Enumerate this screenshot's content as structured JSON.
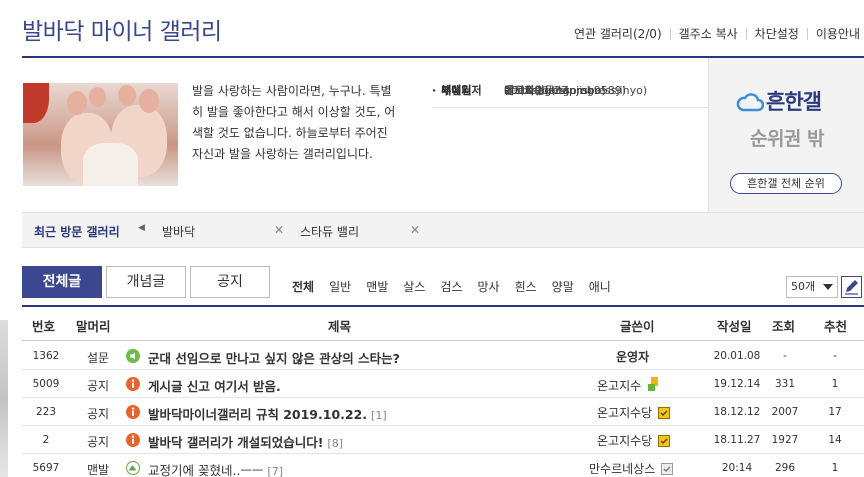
{
  "gallery": {
    "title": "발바닥 마이너 갤러리",
    "intro": "발을 사랑하는 사람이라면, 누구나. 특별히 발을 좋아한다고 해서 이상할 것도, 어색할 것도 없습니다. 하늘로부터 주어진 자신과 발을 사랑하는 갤러리입니다.",
    "info": {
      "manager_label": "매니저",
      "manager": "온고지수(ongojisoo)",
      "submanager_label": "부매니저",
      "submanagers": [
        "박지효연구소(progressjihyo)",
        "에르화(lblossom)",
        "aerttaag(hanmh9589)"
      ],
      "opened_label": "개설일",
      "opened": "2018-11-27"
    }
  },
  "top_links": [
    "연관 갤러리(2/0)",
    "갤주소 복사",
    "차단설정",
    "이용안내"
  ],
  "ranking": {
    "logo": "흔한갤",
    "sub": "순위권 밖",
    "button": "흔한갤 전체 순위"
  },
  "recent": {
    "title": "최근 방문 갤러리",
    "items": [
      "발바닥",
      "스타듀 밸리"
    ]
  },
  "tabs": [
    "전체글",
    "개념글",
    "공지"
  ],
  "subheads": [
    "전체",
    "일반",
    "맨발",
    "살스",
    "검스",
    "망사",
    "흰스",
    "양말",
    "애니"
  ],
  "list_count": "50개",
  "table": {
    "headers": [
      "번호",
      "말머리",
      "제목",
      "글쓴이",
      "작성일",
      "조회",
      "추천"
    ],
    "rows": [
      {
        "num": "1362",
        "head": "설문",
        "title": "군대 선임으로 만나고 싶지 않은 관상의 스타는?",
        "replies": "",
        "writer": "운영자",
        "date": "20.01.08",
        "views": "-",
        "rec": "-"
      },
      {
        "num": "5009",
        "head": "공지",
        "title": "게시글 신고 여기서 받음.",
        "replies": "",
        "writer": "온고지수",
        "date": "19.12.14",
        "views": "331",
        "rec": "1"
      },
      {
        "num": "223",
        "head": "공지",
        "title": "발바닥마이너갤러리 규칙 2019.10.22.",
        "replies": "[1]",
        "writer": "온고지수당",
        "date": "18.12.12",
        "views": "2007",
        "rec": "17"
      },
      {
        "num": "2",
        "head": "공지",
        "title": "발바닥 갤러리가 개설되었습니다!",
        "replies": "[8]",
        "writer": "온고지수당",
        "date": "18.11.27",
        "views": "1927",
        "rec": "14"
      },
      {
        "num": "5697",
        "head": "맨발",
        "title": "교정기에 꽂혔네..ㅡㅡ",
        "replies": "[7]",
        "writer": "만수르네상스",
        "date": "20:14",
        "views": "296",
        "rec": "1"
      }
    ]
  },
  "colors": {
    "brand": "#3b4890",
    "notice_icon": "#e8632d",
    "survey_icon": "#6dbd45"
  }
}
